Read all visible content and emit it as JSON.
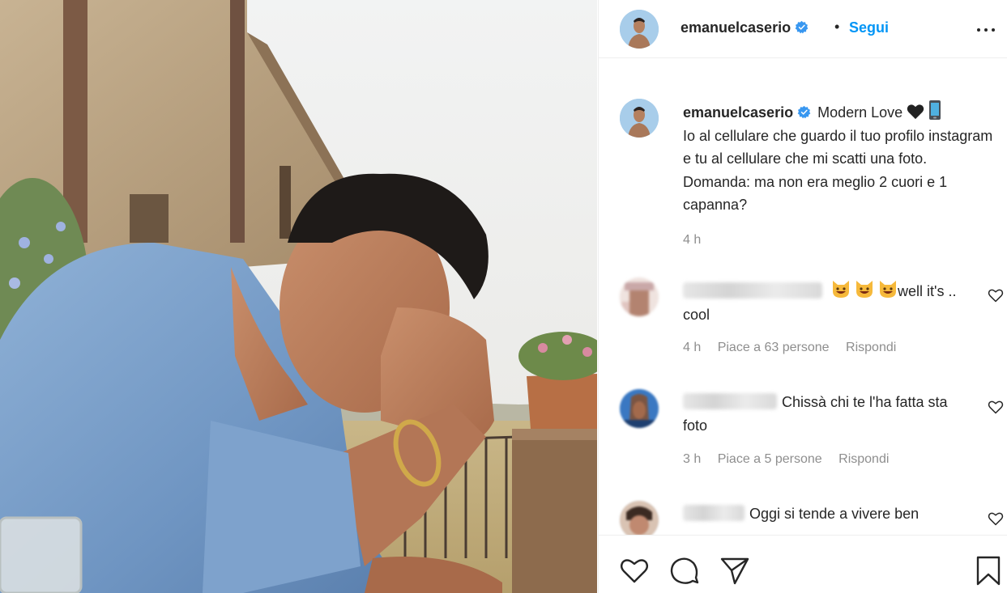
{
  "post": {
    "image_alt": "Foto di emanuelcaserio",
    "author": "emanuelcaserio",
    "verified": true,
    "follow_separator": "•",
    "follow_label": "Segui",
    "more_icon": "more-options-icon"
  },
  "caption": {
    "username": "emanuelcaserio",
    "title": "Modern Love",
    "emojis": [
      "black-heart-icon",
      "mobile-phone-icon"
    ],
    "text": "Io al cellulare che guardo il tuo profilo instagram e tu al cellulare che mi scatti una foto. Domanda: ma non era meglio 2 cuori e 1 capanna?",
    "time": "4 h"
  },
  "comments": [
    {
      "emojis": [
        "grinning-cat-icon",
        "grinning-cat-icon",
        "grinning-cat-icon"
      ],
      "text": "well it's .. cool",
      "time": "4 h",
      "likes": "Piace a 63 persone",
      "reply": "Rispondi"
    },
    {
      "text": "Chissà chi te l'ha fatta sta foto",
      "time": "3 h",
      "likes": "Piace a 5 persone",
      "reply": "Rispondi"
    },
    {
      "text": "Oggi si tende a vivere ben",
      "time": "",
      "likes": "",
      "reply": ""
    }
  ],
  "actions": {
    "icons": [
      "like-heart-icon",
      "comment-icon",
      "share-icon",
      "save-bookmark-icon"
    ]
  },
  "colors": {
    "link_blue": "#0095f6",
    "text": "#262626",
    "muted": "#8e8e8e",
    "border": "#efefef"
  }
}
